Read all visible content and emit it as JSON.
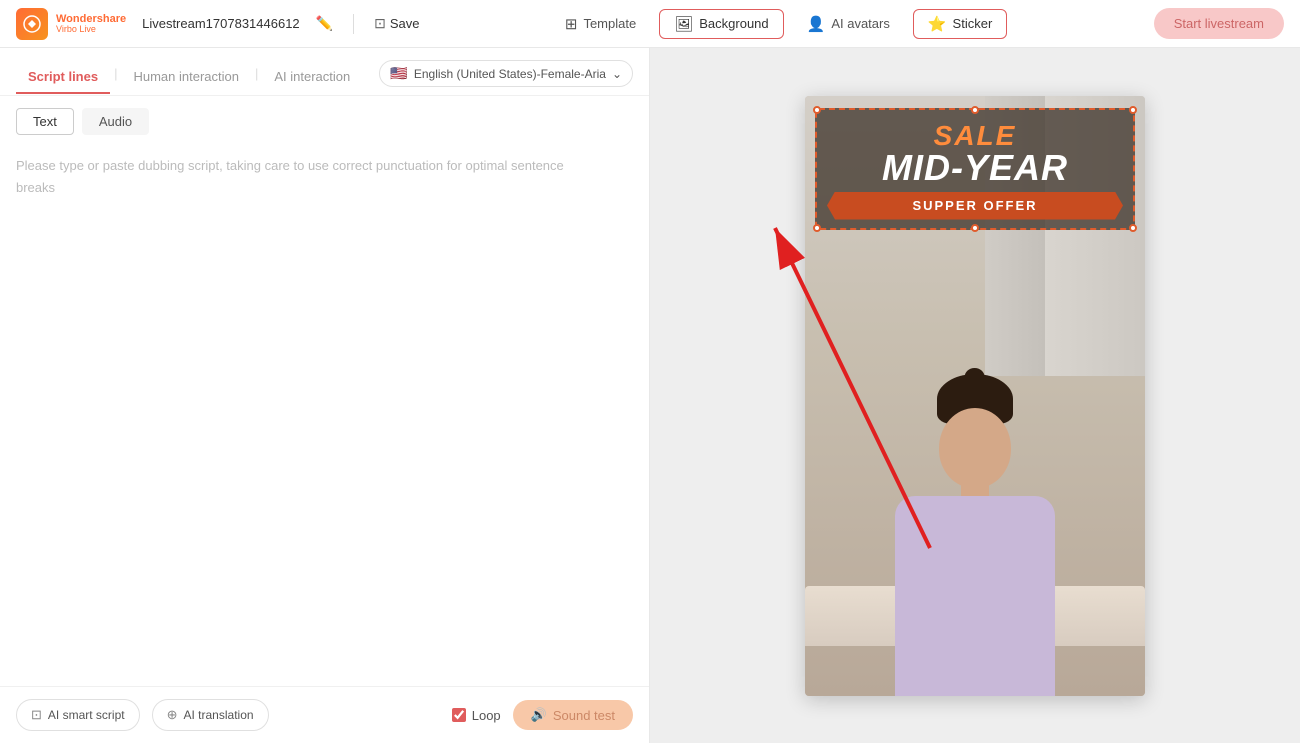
{
  "app": {
    "logo_brand": "Wondershare",
    "logo_sub": "Virbo Live",
    "stream_name": "Livestream1707831446612",
    "save_label": "Save"
  },
  "navbar": {
    "template_label": "Template",
    "background_label": "Background",
    "ai_avatars_label": "AI avatars",
    "sticker_label": "Sticker",
    "start_label": "Start livestream"
  },
  "left_panel": {
    "tab_script": "Script lines",
    "tab_human": "Human interaction",
    "tab_ai": "AI interaction",
    "lang_selector": "English (United States)-Female-Aria",
    "text_btn": "Text",
    "audio_btn": "Audio",
    "placeholder_line1": "Please type or paste dubbing script, taking care to use correct punctuation for optimal sentence",
    "placeholder_line2": "breaks"
  },
  "bottom_bar": {
    "ai_smart_script": "AI smart script",
    "ai_translation": "AI translation",
    "loop_label": "Loop",
    "sound_test": "Sound test"
  },
  "preview": {
    "sale_text": "SALE",
    "mid_year_text": "MID-YEAR",
    "supper_offer_text": "SUPPER OFFER"
  }
}
